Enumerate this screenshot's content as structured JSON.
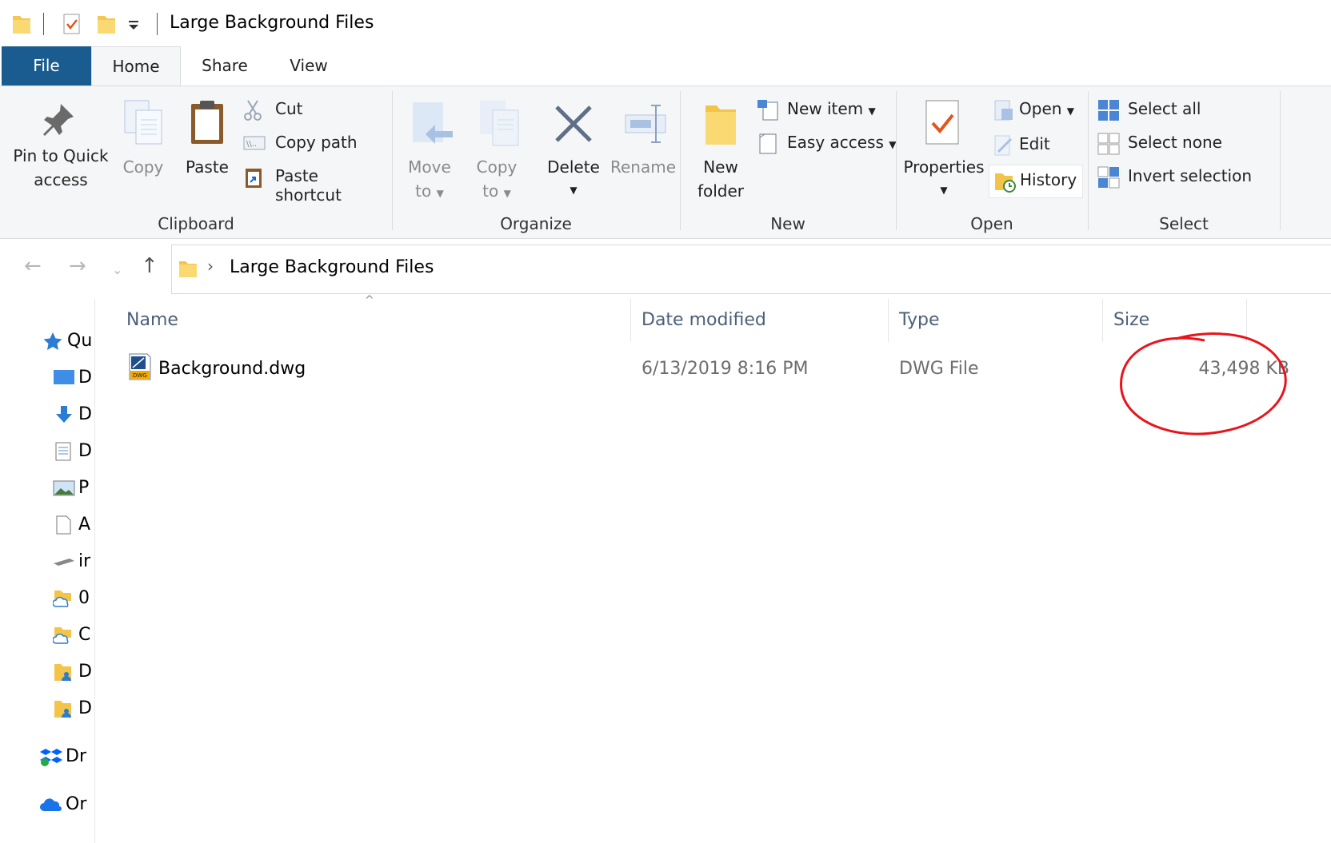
{
  "window": {
    "title": "Large Background Files"
  },
  "tabs": {
    "file": "File",
    "home": "Home",
    "share": "Share",
    "view": "View"
  },
  "ribbon": {
    "clipboard": {
      "label": "Clipboard",
      "pin_line1": "Pin to Quick",
      "pin_line2": "access",
      "copy": "Copy",
      "paste": "Paste",
      "cut": "Cut",
      "copy_path": "Copy path",
      "paste_shortcut": "Paste shortcut"
    },
    "organize": {
      "label": "Organize",
      "move_line1": "Move",
      "move_line2": "to",
      "copy_line1": "Copy",
      "copy_line2": "to",
      "delete": "Delete",
      "rename": "Rename"
    },
    "new": {
      "label": "New",
      "folder_line1": "New",
      "folder_line2": "folder",
      "new_item": "New item",
      "easy_access": "Easy access"
    },
    "open": {
      "label": "Open",
      "properties": "Properties",
      "open": "Open",
      "edit": "Edit",
      "history": "History"
    },
    "select": {
      "label": "Select",
      "select_all": "Select all",
      "select_none": "Select none",
      "invert": "Invert selection"
    }
  },
  "address": {
    "path": "Large Background Files"
  },
  "columns": {
    "name": "Name",
    "date": "Date modified",
    "type": "Type",
    "size": "Size"
  },
  "files": [
    {
      "name": "Background.dwg",
      "date": "6/13/2019 8:16 PM",
      "type": "DWG File",
      "size": "43,498 KB"
    }
  ],
  "navpane": [
    {
      "label": "Qu",
      "icon": "star-icon"
    },
    {
      "label": "D",
      "icon": "desktop-icon"
    },
    {
      "label": "D",
      "icon": "download-icon"
    },
    {
      "label": "D",
      "icon": "document-icon"
    },
    {
      "label": "P",
      "icon": "pictures-icon"
    },
    {
      "label": "A",
      "icon": "file-icon"
    },
    {
      "label": "ir",
      "icon": "drive-icon"
    },
    {
      "label": "0",
      "icon": "cloud-folder-icon"
    },
    {
      "label": "C",
      "icon": "cloud-folder-icon"
    },
    {
      "label": "D",
      "icon": "user-folder-icon"
    },
    {
      "label": "D",
      "icon": "user-folder-icon"
    },
    {
      "label": "Dr",
      "icon": "dropbox-icon"
    },
    {
      "label": "Or",
      "icon": "onedrive-icon"
    }
  ],
  "colors": {
    "file_tab": "#1a5c8f",
    "annotation": "#e8141c",
    "header_text": "#4c607a"
  }
}
